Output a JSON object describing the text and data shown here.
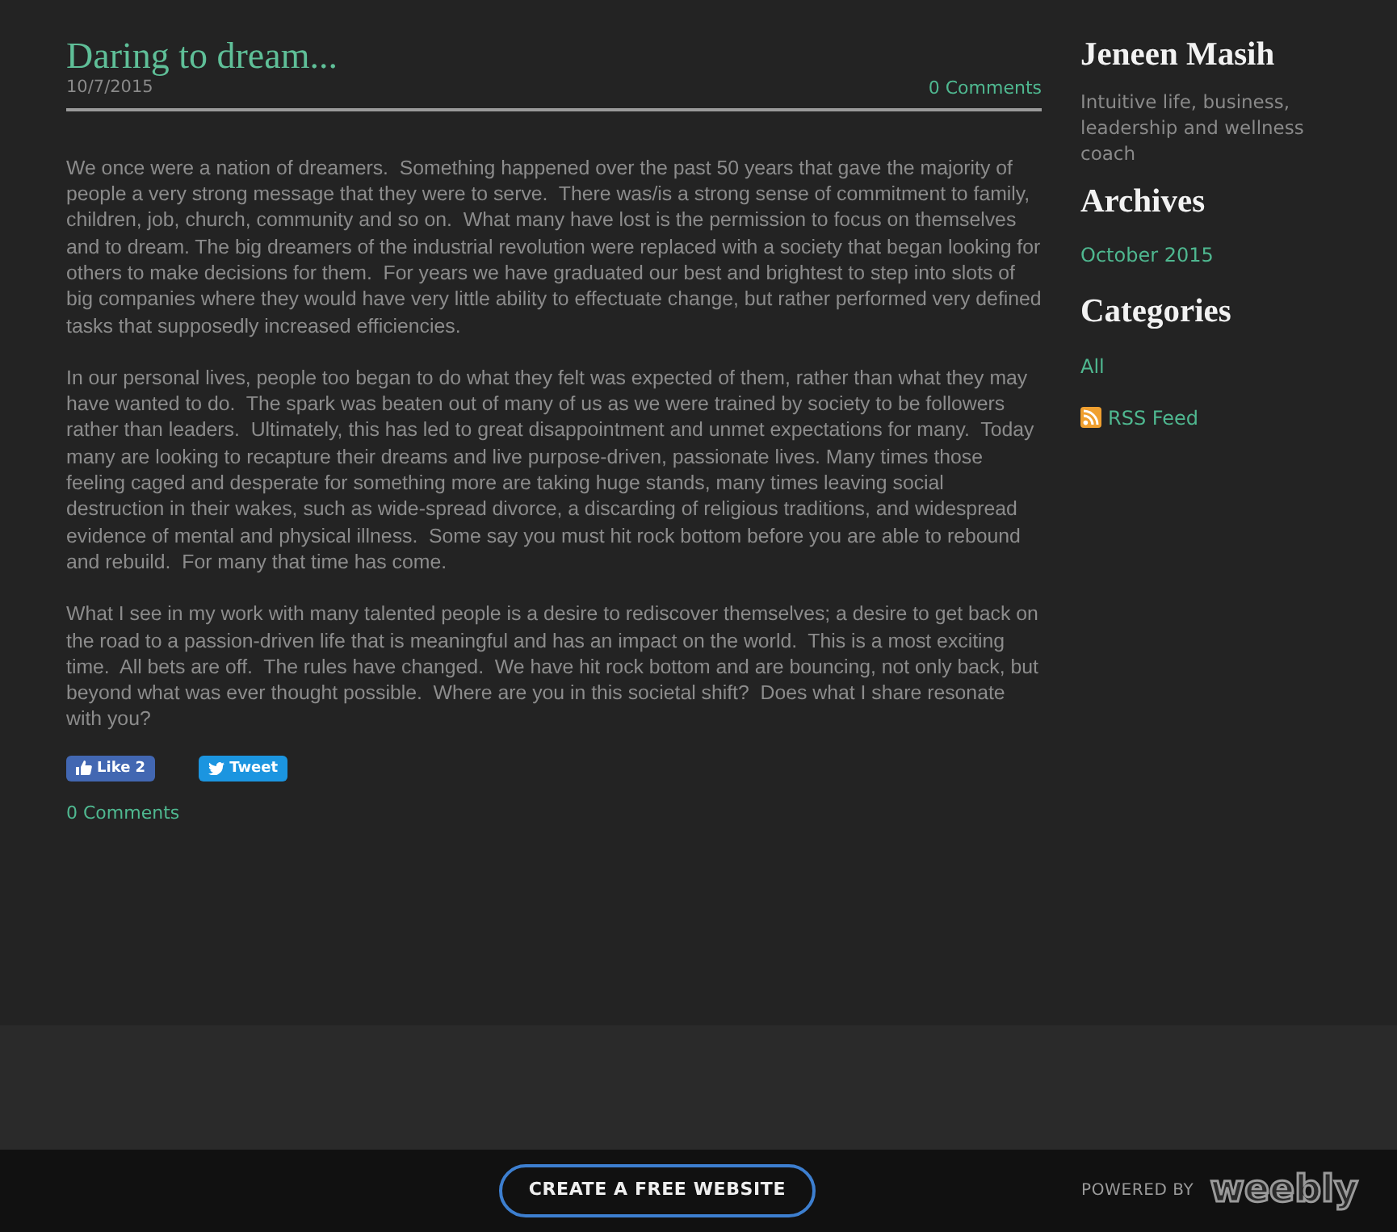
{
  "post": {
    "title": "Daring to dream...",
    "date": "10/7/2015",
    "comments_link": "0 Comments",
    "paragraphs": [
      "We once were a nation of dreamers.  Something happened over the past 50 years that gave the majority of people a very strong message that they were to serve.  There was/is a strong sense of commitment to family, children, job, church, community and so on.  What many have lost is the permission to focus on themselves and to dream. The big dreamers of the industrial revolution were replaced with a society that began looking for others to make decisions for them.  For years we have graduated our best and brightest to step into slots of big companies where they would have very little ability to effectuate change, but rather performed very defined tasks that supposedly increased efficiencies.",
      "In our personal lives, people too began to do what they felt was expected of them, rather than what they may have wanted to do.  The spark was beaten out of many of us as we were trained by society to be followers rather than leaders.  Ultimately, this has led to great disappointment and unmet expectations for many.  Today many are looking to recapture their dreams and live purpose-driven, passionate lives. Many times those feeling caged and desperate for something more are taking huge stands, many times leaving social destruction in their wakes, such as wide-spread divorce, a discarding of religious traditions, and widespread evidence of mental and physical illness.  Some say you must hit rock bottom before you are able to rebound and rebuild.  For many that time has come.",
      "What I see in my work with many talented people is a desire to rediscover themselves; a desire to get back on the road to a passion-driven life that is meaningful and has an impact on the world.  This is a most exciting time.  All bets are off.  The rules have changed.  We have hit rock bottom and are bouncing, not only back, but beyond what was ever thought possible.  Where are you in this societal shift?  Does what I share resonate with you?"
    ],
    "share_buttons": [
      {
        "kind": "like",
        "label": "Like 2"
      },
      {
        "kind": "tweet",
        "label": "Tweet"
      }
    ],
    "footer_comments_link": "0 Comments"
  },
  "sidebar": {
    "author": "Jeneen Masih",
    "tagline": "Intuitive life, business, leadership and wellness  coach",
    "sections": [
      {
        "heading": "Archives",
        "links": [
          "October 2015"
        ]
      },
      {
        "heading": "Categories",
        "links": [
          "All"
        ]
      }
    ],
    "rss_link": "RSS Feed"
  },
  "footer": {
    "button": "CREATE A FREE WEBSITE",
    "powered_by": "POWERED BY",
    "brand": "weebly"
  }
}
